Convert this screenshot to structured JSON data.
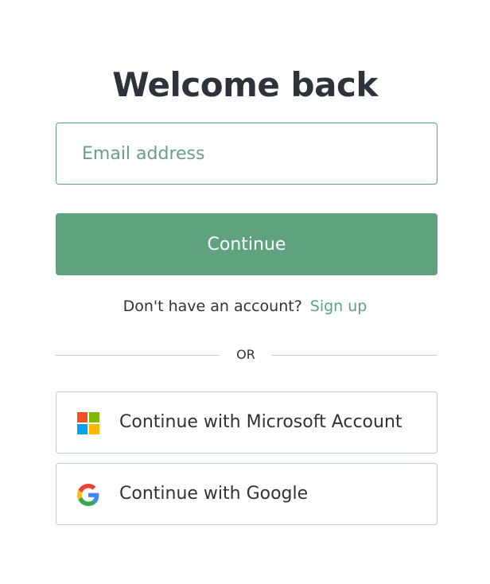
{
  "header": {
    "title": "Welcome back"
  },
  "login_form": {
    "email_placeholder": "Email address",
    "email_value": "",
    "continue_label": "Continue"
  },
  "signup_prompt": {
    "text": "Don't have an account?",
    "link_label": "Sign up"
  },
  "divider": {
    "label": "OR"
  },
  "social_logins": [
    {
      "label": "Continue with Microsoft Account",
      "icon": "microsoft-icon"
    },
    {
      "label": "Continue with Google",
      "icon": "google-icon"
    }
  ],
  "colors": {
    "accent": "#5ea280",
    "text": "#2d333a",
    "border": "#c2c8d0"
  }
}
